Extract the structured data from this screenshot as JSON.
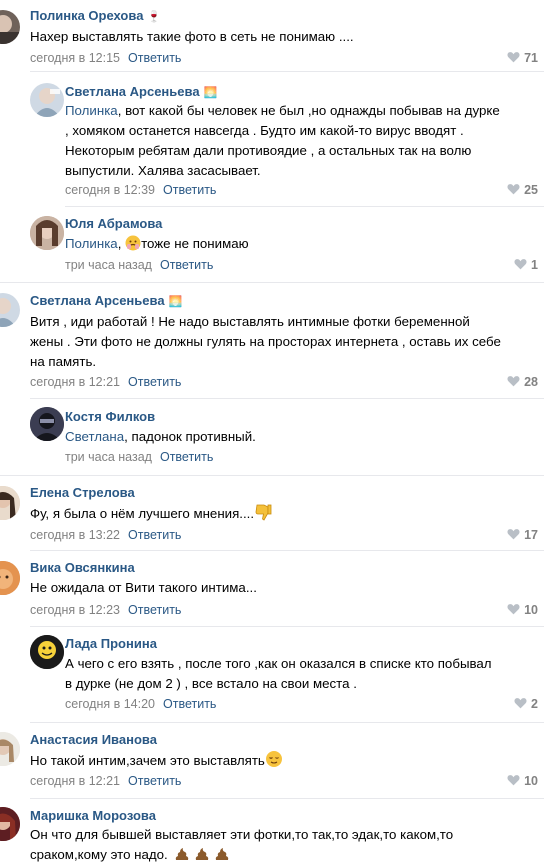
{
  "comments": [
    {
      "author": "Полинка Орехова",
      "author_emoji": "🍷",
      "text": "Нахер выставлять такие фото в сеть не понимаю ....",
      "time": "сегодня в 12:15",
      "reply_label": "Ответить",
      "likes": "71"
    },
    {
      "author": "Светлана Арсеньева",
      "author_emoji": "🌅",
      "mention": "Полинка",
      "text_lines": [
        ", вот какой бы человек не был ,но однажды побывав на дурке",
        ", хомяком останется навсегда . Будто им какой-то вирус вводят .",
        "Некоторым ребятам дали противоядие , а остальных так на волю",
        "выпустили. Халява засасывает."
      ],
      "time": "сегодня в 12:39",
      "reply_label": "Ответить",
      "likes": "25"
    },
    {
      "author": "Юля Абрамова",
      "mention": "Полинка",
      "text": "тоже не понимаю",
      "time": "три часа назад",
      "reply_label": "Ответить",
      "likes": "1"
    },
    {
      "author": "Светлана Арсеньева",
      "author_emoji": "🌅",
      "text_lines": [
        "Витя , иди работай ! Не надо выставлять интимные фотки беременной",
        "жены . Эти фото не должны гулять на просторах интернета , оставь их себе",
        "на память."
      ],
      "time": "сегодня в 12:21",
      "reply_label": "Ответить",
      "likes": "28"
    },
    {
      "author": "Костя Филков",
      "mention": "Светлана",
      "text": ", падонок противный.",
      "time": "три часа назад",
      "reply_label": "Ответить"
    },
    {
      "author": "Елена Стрелова",
      "text": "Фу, я была о нём лучшего мнения....",
      "time": "сегодня в 13:22",
      "reply_label": "Ответить",
      "likes": "17"
    },
    {
      "author": "Вика Овсянкина",
      "text": "Не ожидала от Вити такого интима...",
      "time": "сегодня в 12:23",
      "reply_label": "Ответить",
      "likes": "10"
    },
    {
      "author": "Лада Пронина",
      "text_lines": [
        "А чего с его взять , после того ,как он оказался в списке кто побывал",
        "в дурке (не дом 2 ) , все встало на свои места ."
      ],
      "time": "сегодня в 14:20",
      "reply_label": "Ответить",
      "likes": "2"
    },
    {
      "author": "Анастасия Иванова",
      "text": "Но такой интим,зачем это выставлять",
      "time": "сегодня в 12:21",
      "reply_label": "Ответить",
      "likes": "10"
    },
    {
      "author": "Маришка Морозова",
      "text_lines": [
        "Он что для бывшей выставляет эти фотки,то так,то эдак,то каком,то",
        "сраком,кому это надо."
      ]
    }
  ],
  "colors": {
    "name": "#2a5885",
    "meta": "#828282",
    "divider": "#e7e8ec"
  }
}
